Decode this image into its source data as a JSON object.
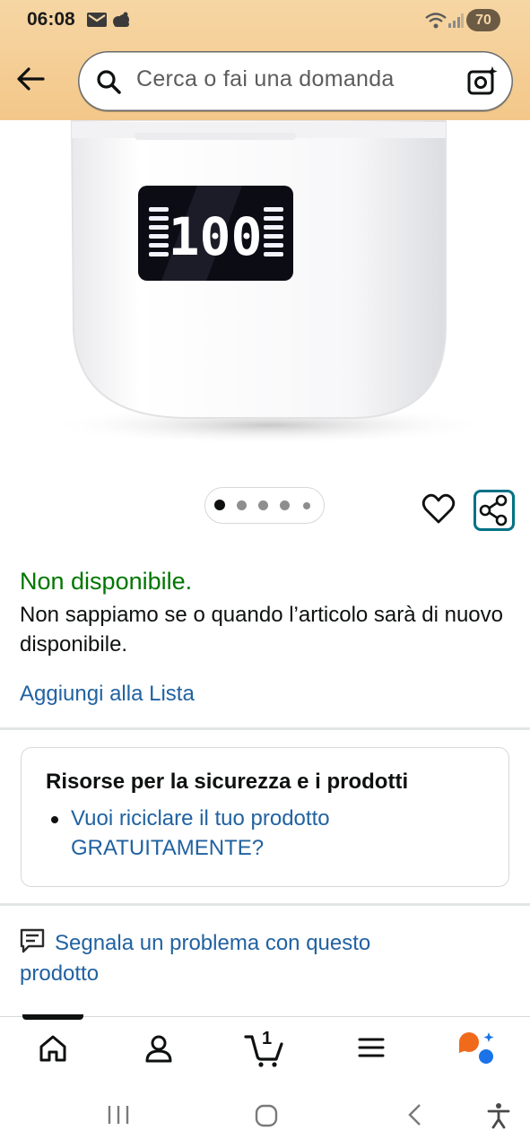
{
  "status_bar": {
    "time": "06:08",
    "battery": "70",
    "icons": [
      "mail-icon",
      "cloud-icon",
      "wifi-icon",
      "signal-icon"
    ]
  },
  "header": {
    "back_icon": "arrow-left-icon",
    "search_placeholder": "Cerca o fai una domanda",
    "search_icon": "search-icon",
    "camera_icon": "camera-icon"
  },
  "product_image": {
    "display_text": "100",
    "carousel_dots": 5,
    "active_dot": 1
  },
  "availability": {
    "status": "Non disponibile.",
    "note": "Non sappiamo se o quando l’articolo sarà di nuovo disponibile.",
    "add_to_list": "Aggiungi alla Lista"
  },
  "safety_card": {
    "title": "Risorse per la sicurezza e i prodotti",
    "link": "Vuoi riciclare il tuo prodotto GRATUITAMENTE?"
  },
  "report": {
    "label": "Segnala un problema con questo prodotto"
  },
  "bottom_nav": {
    "items": [
      "home-icon",
      "account-icon",
      "cart-icon",
      "menu-icon",
      "rufus-icon"
    ],
    "cart_count": "1"
  },
  "colors": {
    "header_bg": "#f3c789",
    "link": "#2162a1",
    "available_green": "#007600",
    "share_border": "#007185"
  }
}
